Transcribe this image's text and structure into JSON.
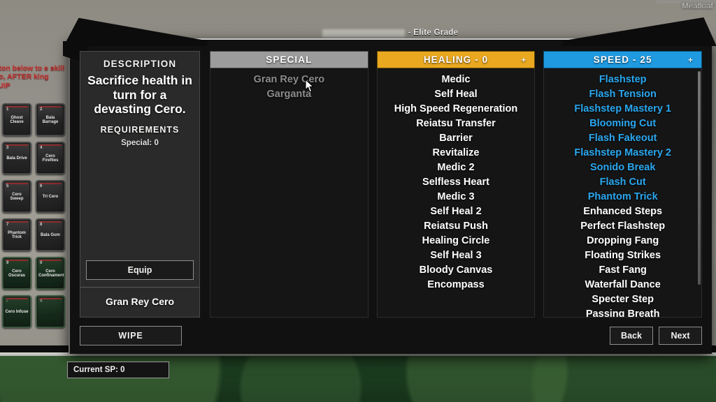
{
  "player": {
    "name": "Meatloaf"
  },
  "hint": {
    "text": "button below to e skill onto, AFTER king EQUIP"
  },
  "window": {
    "title_suffix": "- Elite Grade",
    "title_redacted": true
  },
  "description": {
    "heading": "DESCRIPTION",
    "text": "Sacrifice health in turn for a devasting Cero.",
    "requirements_heading": "REQUIREMENTS",
    "requirements": "Special: 0",
    "equip_label": "Equip",
    "selected_skill": "Gran Rey Cero"
  },
  "columns": [
    {
      "id": "special",
      "header": "SPECIAL",
      "accent": "#9c9c9c",
      "has_plus": false,
      "points": null,
      "scrollbar": false,
      "items": [
        {
          "label": "Gran Rey Cero",
          "state": "dim"
        },
        {
          "label": "Garganta",
          "state": "dim"
        }
      ]
    },
    {
      "id": "healing",
      "header": "HEALING - 0",
      "accent": "#e9a81f",
      "has_plus": true,
      "plus_label": "+",
      "points": 0,
      "scrollbar": false,
      "items": [
        {
          "label": "Medic",
          "state": "normal"
        },
        {
          "label": "Self Heal",
          "state": "normal"
        },
        {
          "label": "High Speed Regeneration",
          "state": "normal"
        },
        {
          "label": "Reiatsu Transfer",
          "state": "normal"
        },
        {
          "label": "Barrier",
          "state": "normal"
        },
        {
          "label": "Revitalize",
          "state": "normal"
        },
        {
          "label": "Medic 2",
          "state": "normal"
        },
        {
          "label": "Selfless Heart",
          "state": "normal"
        },
        {
          "label": "Medic 3",
          "state": "normal"
        },
        {
          "label": "Self Heal 2",
          "state": "normal"
        },
        {
          "label": "Reiatsu Push",
          "state": "normal"
        },
        {
          "label": "Healing Circle",
          "state": "normal"
        },
        {
          "label": "Self Heal 3",
          "state": "normal"
        },
        {
          "label": "Bloody Canvas",
          "state": "normal"
        },
        {
          "label": "Encompass",
          "state": "normal"
        }
      ]
    },
    {
      "id": "speed",
      "header": "SPEED - 25",
      "accent": "#1f9ae0",
      "has_plus": true,
      "plus_label": "+",
      "points": 25,
      "scrollbar": true,
      "items": [
        {
          "label": "Flashstep",
          "state": "unlocked"
        },
        {
          "label": "Flash Tension",
          "state": "unlocked"
        },
        {
          "label": "Flashstep Mastery 1",
          "state": "unlocked"
        },
        {
          "label": "Blooming Cut",
          "state": "unlocked"
        },
        {
          "label": "Flash Fakeout",
          "state": "unlocked"
        },
        {
          "label": "Flashstep Mastery 2",
          "state": "unlocked"
        },
        {
          "label": "Sonido Break",
          "state": "unlocked"
        },
        {
          "label": "Flash Cut",
          "state": "unlocked"
        },
        {
          "label": "Phantom Trick",
          "state": "unlocked"
        },
        {
          "label": "Enhanced Steps",
          "state": "normal"
        },
        {
          "label": "Perfect Flashstep",
          "state": "normal"
        },
        {
          "label": "Dropping Fang",
          "state": "normal"
        },
        {
          "label": "Floating Strikes",
          "state": "normal"
        },
        {
          "label": "Fast Fang",
          "state": "normal"
        },
        {
          "label": "Waterfall Dance",
          "state": "normal"
        },
        {
          "label": "Specter Step",
          "state": "normal"
        },
        {
          "label": "Passing Breath",
          "state": "normal"
        }
      ]
    }
  ],
  "footer": {
    "wipe_label": "WIPE",
    "back_label": "Back",
    "next_label": "Next"
  },
  "status": {
    "sp_label": "Current SP: 0"
  },
  "skill_slots": [
    {
      "num": "1",
      "name": "Ghost Cleave",
      "green": false
    },
    {
      "num": "2",
      "name": "Bala Barrage",
      "green": false
    },
    {
      "num": "3",
      "name": "Bala Drive",
      "green": false
    },
    {
      "num": "4",
      "name": "Cero Fireflies",
      "green": false
    },
    {
      "num": "5",
      "name": "Cero Sweep",
      "green": false
    },
    {
      "num": "6",
      "name": "Tri Cero",
      "green": false
    },
    {
      "num": "7",
      "name": "Phantom Trick",
      "green": false
    },
    {
      "num": "8",
      "name": "Bala Gum",
      "green": false
    },
    {
      "num": "9",
      "name": "Cero Oscuras",
      "green": true
    },
    {
      "num": "0",
      "name": "Cero Confinamento",
      "green": true
    },
    {
      "num": "-",
      "name": "Cero Infuse",
      "green": true
    },
    {
      "num": "=",
      "name": "",
      "green": true
    }
  ]
}
